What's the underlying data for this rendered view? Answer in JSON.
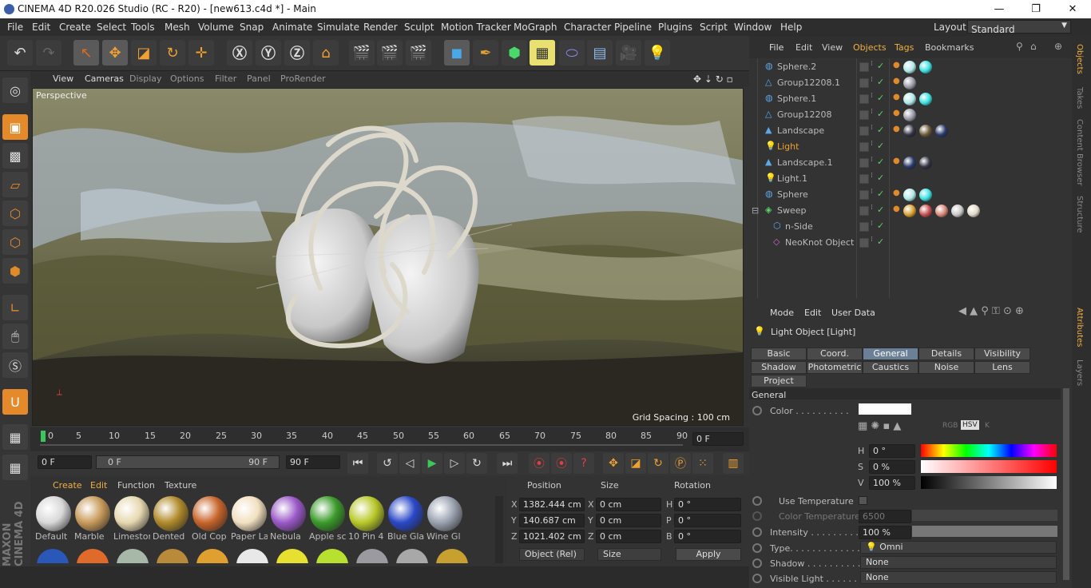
{
  "app": {
    "title": "CINEMA 4D R20.026 Studio (RC - R20) - [new613.c4d *] - Main"
  },
  "menu": [
    "File",
    "Edit",
    "Create",
    "Select",
    "Tools",
    "Mesh",
    "Volume",
    "Snap",
    "Animate",
    "Simulate",
    "Render",
    "Sculpt",
    "Motion Tracker",
    "MoGraph",
    "Character",
    "Pipeline",
    "Plugins",
    "Script",
    "Window",
    "Help"
  ],
  "layout": {
    "label": "Layout:",
    "value": "Standard"
  },
  "viewport": {
    "menu": [
      "View",
      "Cameras",
      "Display",
      "Options",
      "Filter",
      "Panel",
      "ProRender"
    ],
    "camera": "Perspective",
    "grid": "Grid Spacing : 100 cm"
  },
  "timeline": {
    "ticks": [
      "0",
      "5",
      "10",
      "15",
      "20",
      "25",
      "30",
      "35",
      "40",
      "45",
      "50",
      "55",
      "60",
      "65",
      "70",
      "75",
      "80",
      "85",
      "90"
    ],
    "frame": "0 F",
    "start": "0 F",
    "min": "0 F",
    "max": "90 F",
    "end": "90 F"
  },
  "materials": {
    "menu": [
      "Create",
      "Edit",
      "Function",
      "Texture"
    ],
    "items": [
      {
        "name": "Default",
        "color": "#d8d8d8"
      },
      {
        "name": "Marble",
        "color": "#c89a5a"
      },
      {
        "name": "Limestone",
        "color": "#e6d8b0"
      },
      {
        "name": "Dented",
        "color": "#b08a2a"
      },
      {
        "name": "Old Cop",
        "color": "#c8642a"
      },
      {
        "name": "Paper La",
        "color": "#f2e0c0"
      },
      {
        "name": "Nebula",
        "color": "#9a58c8"
      },
      {
        "name": "Apple sc",
        "color": "#3a9a2a"
      },
      {
        "name": "10 Pin 4",
        "color": "#b8c828"
      },
      {
        "name": "Blue Gla",
        "color": "#2a48c8"
      },
      {
        "name": "Wine Gl",
        "color": "#9aa2b0"
      }
    ]
  },
  "coords": {
    "headers": [
      "Position",
      "Size",
      "Rotation"
    ],
    "rows": [
      {
        "a": "X",
        "pv": "1382.444 cm",
        "b": "X",
        "sv": "0 cm",
        "c": "H",
        "rv": "0 °"
      },
      {
        "a": "Y",
        "pv": "140.687 cm",
        "b": "Y",
        "sv": "0 cm",
        "c": "P",
        "rv": "0 °"
      },
      {
        "a": "Z",
        "pv": "1021.402 cm",
        "b": "Z",
        "sv": "0 cm",
        "c": "B",
        "rv": "0 °"
      }
    ],
    "mode": "Object (Rel)",
    "size": "Size",
    "apply": "Apply"
  },
  "objects": {
    "menu": [
      "File",
      "Edit",
      "View",
      "Objects",
      "Tags",
      "Bookmarks"
    ],
    "list": [
      {
        "name": "Sphere.2",
        "icon": "sphere-icon",
        "color": "#bbb",
        "tags": [
          "#b0e8e8",
          "#3ce0e0"
        ]
      },
      {
        "name": "Group12208.1",
        "icon": "polygon-icon",
        "color": "#bbb",
        "tags": [
          "#9a9aa8"
        ]
      },
      {
        "name": "Sphere.1",
        "icon": "sphere-icon",
        "color": "#bbb",
        "tags": [
          "#b0e8e8",
          "#3ce0e0"
        ]
      },
      {
        "name": "Group12208",
        "icon": "polygon-icon",
        "color": "#bbb",
        "tags": [
          "#9a9aa8"
        ]
      },
      {
        "name": "Landscape",
        "icon": "landscape-icon",
        "color": "#bbb",
        "tags": [
          "#334",
          "#6a5a3a",
          "#2a3a6a"
        ]
      },
      {
        "name": "Light",
        "icon": "light-icon",
        "color": "#f0a030",
        "tags": []
      },
      {
        "name": "Landscape.1",
        "icon": "landscape-icon",
        "color": "#bbb",
        "tags": [
          "#2a3a6a",
          "#334"
        ]
      },
      {
        "name": "Light.1",
        "icon": "light-icon",
        "color": "#bbb",
        "tags": []
      },
      {
        "name": "Sphere",
        "icon": "sphere-icon",
        "color": "#bbb",
        "tags": [
          "#b0e8e8",
          "#3ce0e0"
        ]
      },
      {
        "name": "Sweep",
        "icon": "sweep-icon",
        "color": "#bbb",
        "tags": [
          "#d8a030",
          "#c85050",
          "#d88878",
          "#c8c8c8",
          "#e0d8c8"
        ]
      },
      {
        "name": "n-Side",
        "icon": "nside-icon",
        "color": "#bbb",
        "tags": []
      },
      {
        "name": "NeoKnot Object",
        "icon": "knot-icon",
        "color": "#bbb",
        "tags": []
      }
    ]
  },
  "attributes": {
    "menu": [
      "Mode",
      "Edit",
      "User Data"
    ],
    "title": "Light Object [Light]",
    "tabs": [
      "Basic",
      "Coord.",
      "General",
      "Details",
      "Visibility",
      "Shadow",
      "Photometric",
      "Caustics",
      "Noise",
      "Lens",
      "Project"
    ],
    "section": "General",
    "color_label": "Color . . . . . . . . . .",
    "color_modes": [
      "RGB",
      "HSV",
      "K"
    ],
    "h": {
      "label": "H",
      "value": "0 °"
    },
    "s": {
      "label": "S",
      "value": "0 %"
    },
    "v": {
      "label": "V",
      "value": "100 %"
    },
    "use_temp": "Use Temperature",
    "color_temp": {
      "label": "Color Temperature",
      "value": "6500"
    },
    "intensity": {
      "label": "Intensity . . . . . . . . . .",
      "value": "100 %"
    },
    "type": {
      "label": "Type. . . . . . . . . . . . .",
      "value": "Omni"
    },
    "shadow": {
      "label": "Shadow . . . . . . . . . .",
      "value": "None"
    },
    "visible_light": {
      "label": "Visible Light . . . . . . .",
      "value": "None"
    }
  },
  "sidetabs": [
    "Objects",
    "Takes",
    "Content Browser",
    "Structure",
    "Attributes",
    "Layers"
  ]
}
